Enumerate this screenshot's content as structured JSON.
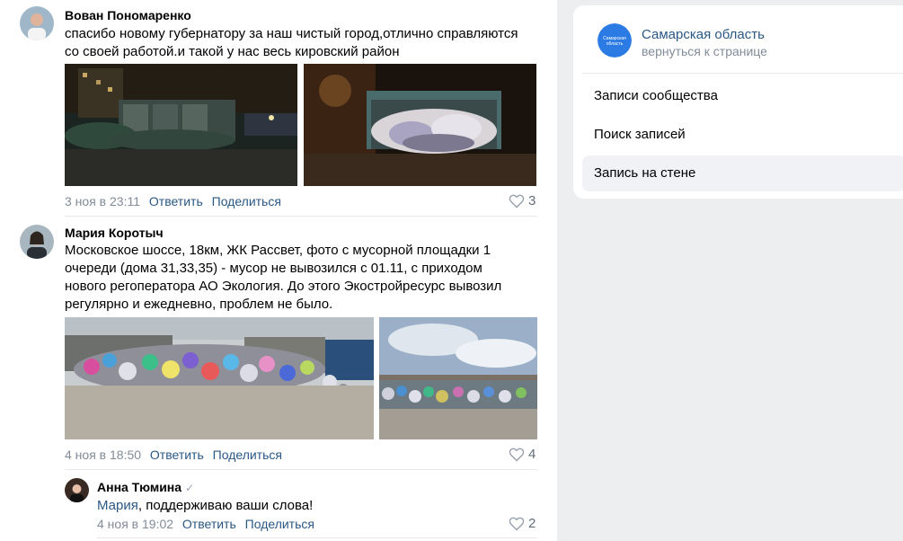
{
  "posts": [
    {
      "author": "Вован Пономаренко",
      "text_lines": [
        "спасибо новому губернатору за наш чистый город,отлично справляются",
        "со своей работой.и такой у нас весь кировский район"
      ],
      "date": "3 ноя в 23:11",
      "reply": "Ответить",
      "share": "Поделиться",
      "likes": "3"
    },
    {
      "author": "Мария Коротыч",
      "text_lines": [
        "Московское шоссе, 18км, ЖК Рассвет, фото с мусорной площадки 1",
        "очереди (дома 31,33,35) - мусор не вывозился с 01.11, с приходом",
        "нового регоператора АО Экология. До этого Экостройресурс вывозил",
        "регулярно и ежедневно, проблем не было."
      ],
      "date": "4 ноя в 18:50",
      "reply": "Ответить",
      "share": "Поделиться",
      "likes": "4"
    }
  ],
  "comment": {
    "author": "Анна Тюмина",
    "mention": "Мария",
    "text": ", поддерживаю ваши слова!",
    "date": "4 ноя в 19:02",
    "reply": "Ответить",
    "share": "Поделиться",
    "likes": "2"
  },
  "sidebar": {
    "group_name": "Самарская область",
    "group_back": "вернуться к странице",
    "logo_text": "Самарская область",
    "menu": [
      "Записи сообщества",
      "Поиск записей",
      "Запись на стене"
    ]
  },
  "colors": {
    "link": "#2a5885",
    "meta": "#818c99",
    "logo": "#2c7be5"
  }
}
